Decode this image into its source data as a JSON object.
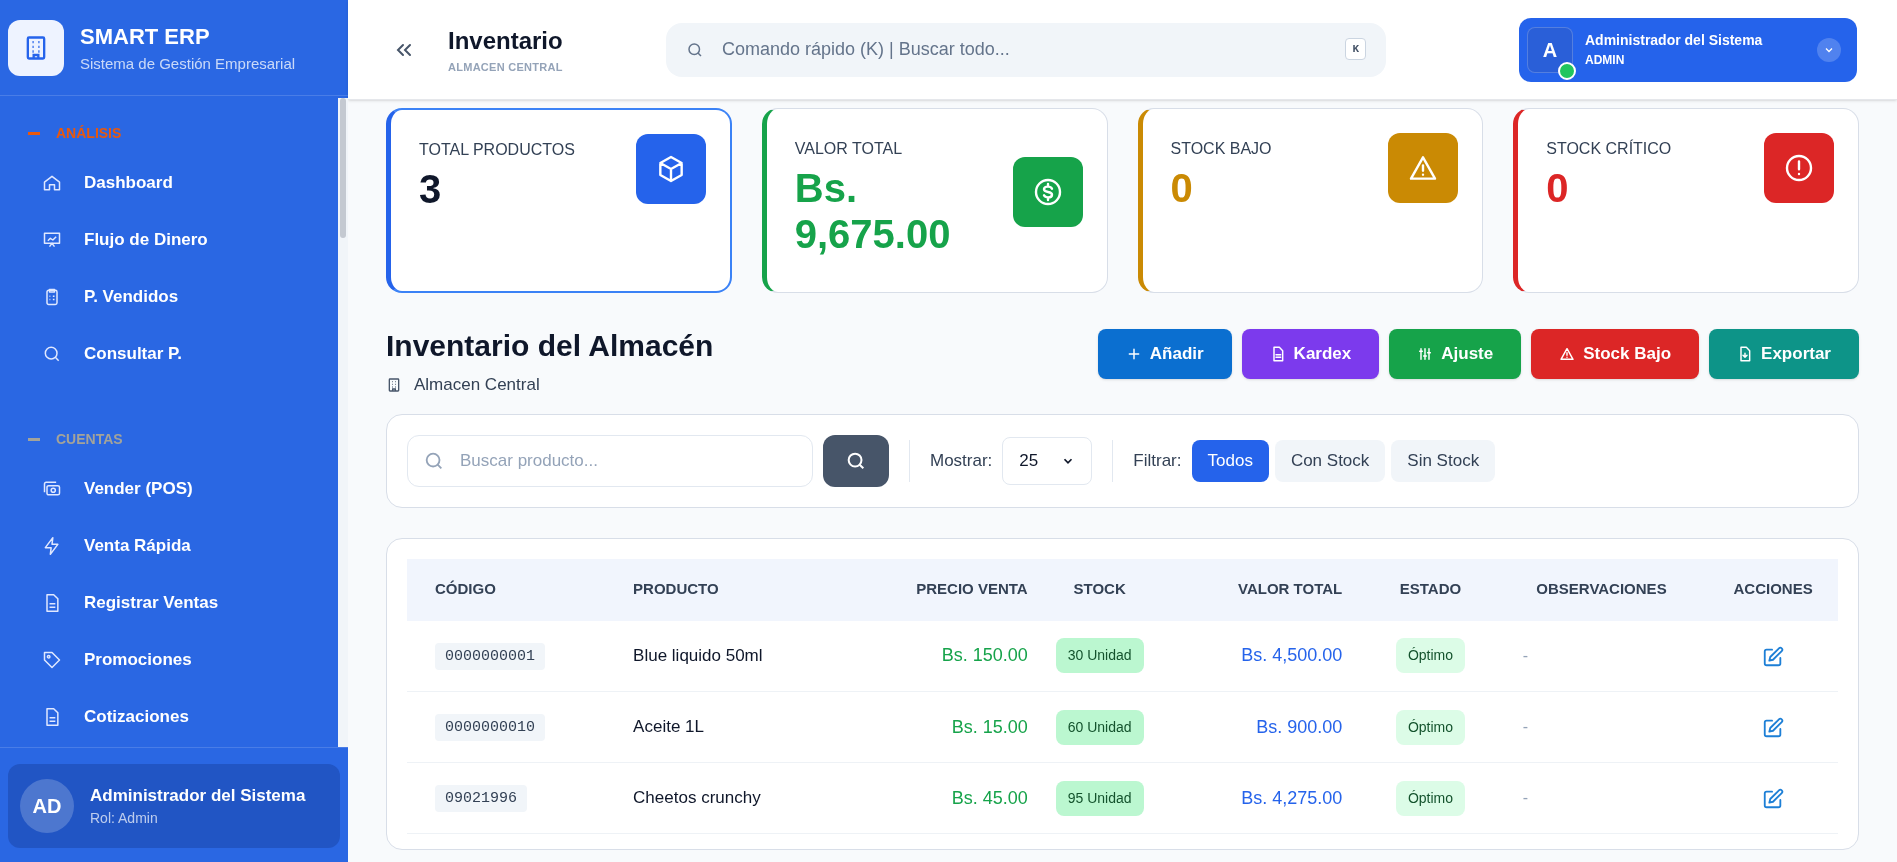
{
  "sidebar": {
    "brand": {
      "title": "SMART ERP",
      "subtitle": "Sistema de Gestión Empresarial"
    },
    "sections": [
      {
        "title": "ANÁLISIS",
        "color": "#ea580c",
        "items": [
          {
            "label": "Dashboard"
          },
          {
            "label": "Flujo de Dinero"
          },
          {
            "label": "P. Vendidos"
          },
          {
            "label": "Consultar P."
          }
        ]
      },
      {
        "title": "CUENTAS",
        "color": "#a3a39a",
        "items": [
          {
            "label": "Vender (POS)"
          },
          {
            "label": "Venta Rápida"
          },
          {
            "label": "Registrar Ventas"
          },
          {
            "label": "Promociones"
          },
          {
            "label": "Cotizaciones"
          }
        ]
      }
    ],
    "user": {
      "initials": "AD",
      "name": "Administrador del Sistema",
      "role": "Rol: Admin"
    }
  },
  "header": {
    "title": "Inventario",
    "subtitle": "ALMACEN CENTRAL",
    "search": {
      "placeholder": "Comando rápido (K) | Buscar todo...",
      "shortcut": "K"
    },
    "user": {
      "initial": "A",
      "name": "Administrador del Sistema",
      "role": "ADMIN",
      "online": true
    }
  },
  "stats": [
    {
      "label": "TOTAL PRODUCTOS",
      "value": "3",
      "color": "#2563eb",
      "selected": true
    },
    {
      "label": "VALOR TOTAL",
      "value": "Bs. 9,675.00",
      "color": "#16a34a",
      "selected": false
    },
    {
      "label": "STOCK BAJO",
      "value": "0",
      "color": "#ca8a04",
      "selected": false
    },
    {
      "label": "STOCK CRÍTICO",
      "value": "0",
      "color": "#dc2626",
      "selected": false
    }
  ],
  "page": {
    "title": "Inventario del Almacén",
    "subtitle": "Almacen Central"
  },
  "actions": [
    {
      "label": "Añadir",
      "color": "#0b6fd0"
    },
    {
      "label": "Kardex",
      "color": "#7c3aed"
    },
    {
      "label": "Ajuste",
      "color": "#16a34a"
    },
    {
      "label": "Stock Bajo",
      "color": "#dc2626"
    },
    {
      "label": "Exportar",
      "color": "#0d9488"
    }
  ],
  "filters": {
    "search": {
      "placeholder": "Buscar producto..."
    },
    "show_label": "Mostrar:",
    "show_value": "25",
    "filter_label": "Filtrar:",
    "chips": [
      {
        "label": "Todos",
        "selected": true
      },
      {
        "label": "Con Stock",
        "selected": false
      },
      {
        "label": "Sin Stock",
        "selected": false
      }
    ]
  },
  "table": {
    "columns": [
      "CÓDIGO",
      "PRODUCTO",
      "PRECIO VENTA",
      "STOCK",
      "VALOR TOTAL",
      "ESTADO",
      "OBSERVACIONES",
      "ACCIONES"
    ],
    "rows": [
      {
        "code": "0000000001",
        "product": "Blue liquido 50ml",
        "price": "Bs. 150.00",
        "stock": "30 Unidad",
        "total": "Bs. 4,500.00",
        "status": "Óptimo",
        "notes": "-"
      },
      {
        "code": "0000000010",
        "product": "Aceite 1L",
        "price": "Bs. 15.00",
        "stock": "60 Unidad",
        "total": "Bs. 900.00",
        "status": "Óptimo",
        "notes": "-"
      },
      {
        "code": "09021996",
        "product": "Cheetos crunchy",
        "price": "Bs. 45.00",
        "stock": "95 Unidad",
        "total": "Bs. 4,275.00",
        "status": "Óptimo",
        "notes": "-"
      }
    ]
  }
}
